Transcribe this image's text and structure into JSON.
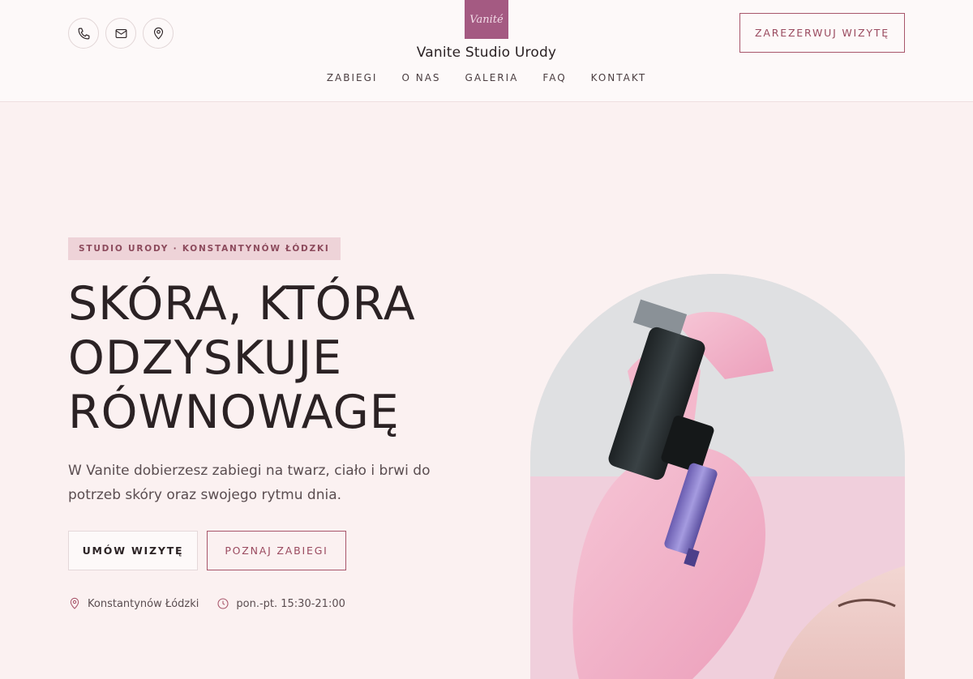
{
  "header": {
    "brand_name": "Vanite Studio Urody",
    "logo_text": "Vanité",
    "reserve_label": "ZAREZERWUJ WIZYTĘ",
    "contact_icons": [
      "phone-icon",
      "mail-icon",
      "location-icon"
    ],
    "nav": [
      "ZABIEGI",
      "O NAS",
      "GALERIA",
      "FAQ",
      "KONTAKT"
    ]
  },
  "hero": {
    "badge": "STUDIO URODY · KONSTANTYNÓW ŁÓDZKI",
    "title_lines": [
      "SKÓRA, KTÓRA",
      "ODZYSKUJE",
      "RÓWNOWAGĘ"
    ],
    "description": "W Vanite dobierzesz zabiegi na twarz, ciało i brwi do potrzeb skóry oraz swojego rytmu dnia.",
    "primary_button": "UMÓW WIZYTĘ",
    "secondary_button": "POZNAJ ZABIEGI",
    "info": {
      "location": "Konstantynów Łódzki",
      "hours": "pon.-pt. 15:30-21:00"
    }
  },
  "colors": {
    "accent": "#a8566b",
    "background": "#fbf1f1",
    "header_bg": "#fdf9f9",
    "badge_bg": "#eed3d8",
    "logo_bg": "#a45a82",
    "text": "#2b2224"
  }
}
